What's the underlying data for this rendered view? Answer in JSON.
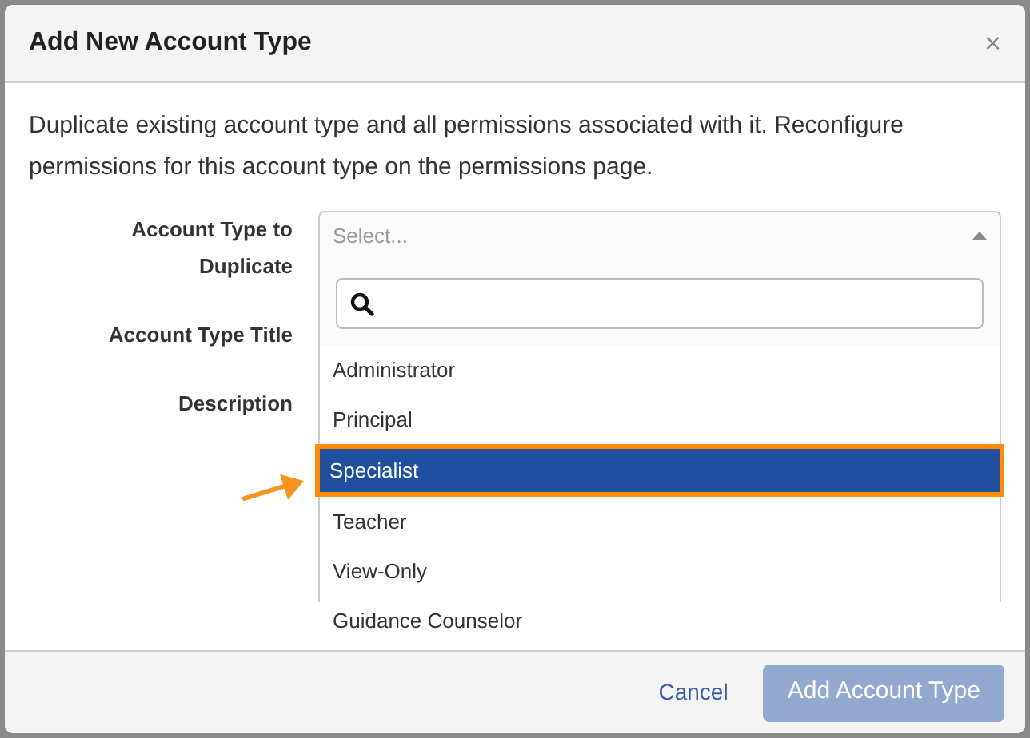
{
  "dialog": {
    "title": "Add New Account Type",
    "close": "×",
    "description": "Duplicate existing account type and all permissions associated with it. Reconfigure permissions for this account type on the permissions page."
  },
  "form": {
    "labels": [
      "Account Type to Duplicate",
      "Account Type Title",
      "Description"
    ],
    "select": {
      "placeholder": "Select...",
      "expanded": true,
      "options": [
        {
          "label": "Administrator",
          "selected": false
        },
        {
          "label": "Principal",
          "selected": false
        },
        {
          "label": "Specialist",
          "selected": true
        },
        {
          "label": "Teacher",
          "selected": false
        },
        {
          "label": "View-Only",
          "selected": false
        },
        {
          "label": "Guidance Counselor",
          "selected": false
        }
      ]
    }
  },
  "footer": {
    "cancel": "Cancel",
    "submit": {
      "label": "Add Account Type",
      "disabled": true
    }
  }
}
